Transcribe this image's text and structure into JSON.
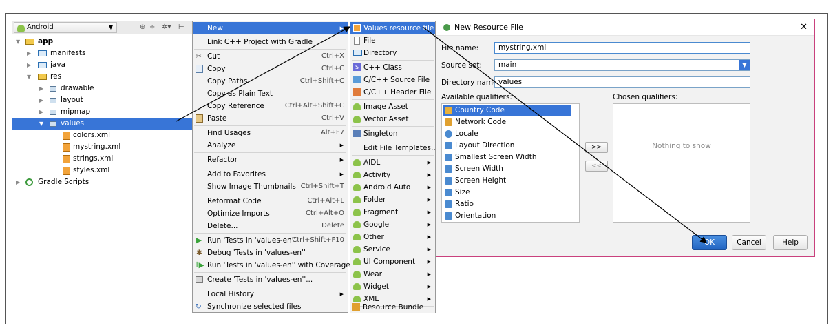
{
  "project_panel": {
    "view_mode": "Android",
    "tree": [
      {
        "label": "app"
      },
      {
        "label": "manifests"
      },
      {
        "label": "java"
      },
      {
        "label": "res"
      },
      {
        "label": "drawable"
      },
      {
        "label": "layout"
      },
      {
        "label": "mipmap"
      },
      {
        "label": "values"
      },
      {
        "label": "colors.xml"
      },
      {
        "label": "mystring.xml"
      },
      {
        "label": "strings.xml"
      },
      {
        "label": "styles.xml"
      },
      {
        "label": "Gradle Scripts"
      }
    ]
  },
  "context_menu": {
    "items": [
      {
        "label": "New",
        "shortcut": ""
      },
      {
        "label": "Link C++ Project with Gradle",
        "shortcut": ""
      },
      {
        "label": "Cut",
        "shortcut": "Ctrl+X"
      },
      {
        "label": "Copy",
        "shortcut": "Ctrl+C"
      },
      {
        "label": "Copy Paths",
        "shortcut": "Ctrl+Shift+C"
      },
      {
        "label": "Copy as Plain Text",
        "shortcut": ""
      },
      {
        "label": "Copy Reference",
        "shortcut": "Ctrl+Alt+Shift+C"
      },
      {
        "label": "Paste",
        "shortcut": "Ctrl+V"
      },
      {
        "label": "Find Usages",
        "shortcut": "Alt+F7"
      },
      {
        "label": "Analyze",
        "shortcut": ""
      },
      {
        "label": "Refactor",
        "shortcut": ""
      },
      {
        "label": "Add to Favorites",
        "shortcut": ""
      },
      {
        "label": "Show Image Thumbnails",
        "shortcut": "Ctrl+Shift+T"
      },
      {
        "label": "Reformat Code",
        "shortcut": "Ctrl+Alt+L"
      },
      {
        "label": "Optimize Imports",
        "shortcut": "Ctrl+Alt+O"
      },
      {
        "label": "Delete...",
        "shortcut": "Delete"
      },
      {
        "label": "Run 'Tests in 'values-en''",
        "shortcut": "Ctrl+Shift+F10"
      },
      {
        "label": "Debug 'Tests in 'values-en''",
        "shortcut": ""
      },
      {
        "label": "Run 'Tests in 'values-en'' with Coverage",
        "shortcut": ""
      },
      {
        "label": "Create 'Tests in 'values-en''...",
        "shortcut": ""
      },
      {
        "label": "Local History",
        "shortcut": ""
      },
      {
        "label": "Synchronize selected files",
        "shortcut": ""
      }
    ]
  },
  "new_submenu": {
    "items": [
      {
        "label": "Values resource file"
      },
      {
        "label": "File"
      },
      {
        "label": "Directory"
      },
      {
        "label": "C++ Class"
      },
      {
        "label": "C/C++ Source File"
      },
      {
        "label": "C/C++ Header File"
      },
      {
        "label": "Image Asset"
      },
      {
        "label": "Vector Asset"
      },
      {
        "label": "Singleton"
      },
      {
        "label": "Edit File Templates..."
      },
      {
        "label": "AIDL"
      },
      {
        "label": "Activity"
      },
      {
        "label": "Android Auto"
      },
      {
        "label": "Folder"
      },
      {
        "label": "Fragment"
      },
      {
        "label": "Google"
      },
      {
        "label": "Other"
      },
      {
        "label": "Service"
      },
      {
        "label": "UI Component"
      },
      {
        "label": "Wear"
      },
      {
        "label": "Widget"
      },
      {
        "label": "XML"
      },
      {
        "label": "Resource Bundle"
      }
    ]
  },
  "dialog": {
    "title": "New Resource File",
    "file_name_label": "File name:",
    "file_name_value": "mystring.xml",
    "source_set_label": "Source set:",
    "source_set_value": "main",
    "directory_label": "Directory name:",
    "directory_value": "values",
    "available_label": "Available qualifiers:",
    "chosen_label": "Chosen qualifiers:",
    "qualifiers": [
      "Country Code",
      "Network Code",
      "Locale",
      "Layout Direction",
      "Smallest Screen Width",
      "Screen Width",
      "Screen Height",
      "Size",
      "Ratio",
      "Orientation"
    ],
    "empty_text": "Nothing to show",
    "add_button": ">>",
    "remove_button": "<<",
    "ok": "OK",
    "cancel": "Cancel",
    "help": "Help"
  },
  "colors": {
    "selection": "#3875d7",
    "android_green": "#8cc34a",
    "dialog_border": "#c9417d"
  }
}
